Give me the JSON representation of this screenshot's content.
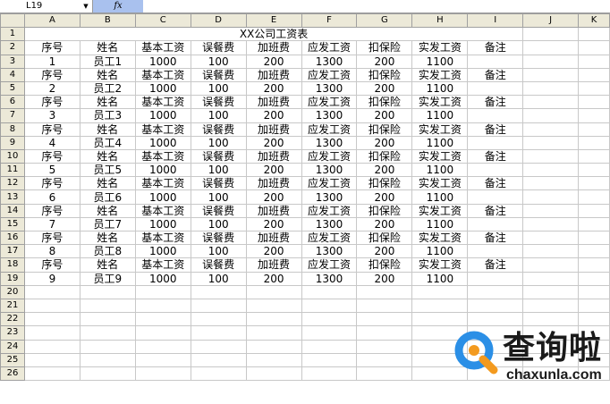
{
  "formula_bar": {
    "name_box": "L19",
    "dropdown_icon": "dropdown-arrow-icon",
    "fx_label": "fx",
    "formula": ""
  },
  "columns": [
    "A",
    "B",
    "C",
    "D",
    "E",
    "F",
    "G",
    "H",
    "I",
    "J",
    "K"
  ],
  "row_numbers": [
    "1",
    "2",
    "3",
    "4",
    "5",
    "6",
    "7",
    "8",
    "9",
    "10",
    "11",
    "12",
    "13",
    "14",
    "15",
    "16",
    "17",
    "18",
    "19",
    "20",
    "21",
    "22",
    "23",
    "24",
    "25",
    "26"
  ],
  "sheet": {
    "title": "XX公司工资表",
    "header": [
      "序号",
      "姓名",
      "基本工资",
      "误餐费",
      "加班费",
      "应发工资",
      "扣保险",
      "实发工资",
      "备注"
    ],
    "records": [
      [
        "1",
        "员工1",
        "1000",
        "100",
        "200",
        "1300",
        "200",
        "1100"
      ],
      [
        "2",
        "员工2",
        "1000",
        "100",
        "200",
        "1300",
        "200",
        "1100"
      ],
      [
        "3",
        "员工3",
        "1000",
        "100",
        "200",
        "1300",
        "200",
        "1100"
      ],
      [
        "4",
        "员工4",
        "1000",
        "100",
        "200",
        "1300",
        "200",
        "1100"
      ],
      [
        "5",
        "员工5",
        "1000",
        "100",
        "200",
        "1300",
        "200",
        "1100"
      ],
      [
        "6",
        "员工6",
        "1000",
        "100",
        "200",
        "1300",
        "200",
        "1100"
      ],
      [
        "7",
        "员工7",
        "1000",
        "100",
        "200",
        "1300",
        "200",
        "1100"
      ],
      [
        "8",
        "员工8",
        "1000",
        "100",
        "200",
        "1300",
        "200",
        "1100"
      ],
      [
        "9",
        "员工9",
        "1000",
        "100",
        "200",
        "1300",
        "200",
        "1100"
      ]
    ]
  },
  "watermark": {
    "brand": "查询啦",
    "domain": "chaxunla.com"
  },
  "colors": {
    "fx_highlight": "#a9c1ee",
    "header_bg": "#ece9d8",
    "logo_blue": "#2b8fe6",
    "logo_orange": "#f39a1f"
  }
}
